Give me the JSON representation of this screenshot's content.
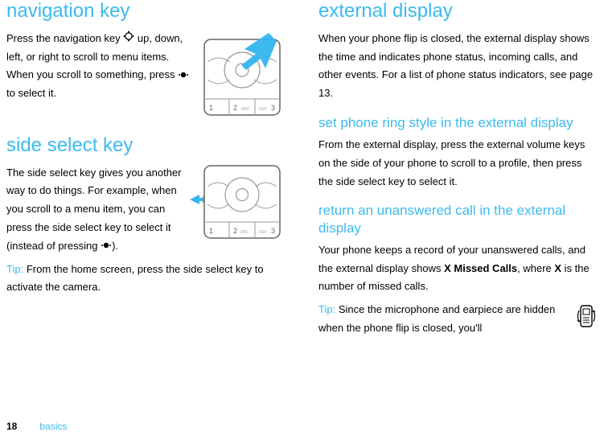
{
  "left": {
    "nav_heading": "navigation key",
    "nav_p1a": "Press the navigation key ",
    "nav_p1b": " up, down, left, or right to scroll to menu items. When you scroll to something, press ",
    "nav_p1c": " to select it.",
    "side_heading": "side select key",
    "side_p1a": "The side select key gives you another way to do things. For example, when you scroll to a menu item, you can press the side select key to select it (instead of pressing ",
    "side_p1b": ").",
    "tip_label": "Tip:",
    "side_tip": " From the home screen, press the side select key to activate the camera."
  },
  "right": {
    "ext_heading": "external display",
    "ext_p1": "When your phone flip is closed, the external display shows the time and indicates phone status, incoming calls, and other events. For a list of phone status indicators, see page 13.",
    "ring_heading": "set phone ring style in the external display",
    "ring_p1": "From the external display, press the external volume keys on the side of your phone to scroll to a profile, then press the side select key to select it.",
    "return_heading": "return an unanswered call in the external display",
    "return_p1a": "Your phone keeps a record of your unanswered calls, and the external display shows ",
    "return_bold1": "X Missed Calls",
    "return_p1b": ", where ",
    "return_bold2": "X",
    "return_p1c": " is the number of missed calls.",
    "tip_label": "Tip:",
    "flip_tip": " Since the microphone and earpiece are hidden when the phone flip is closed, you'll"
  },
  "footer": {
    "page": "18",
    "section": "basics"
  },
  "icons": {
    "nav_key": "nav-key-icon",
    "center_key": "center-key-icon",
    "flip": "flip-icon"
  }
}
